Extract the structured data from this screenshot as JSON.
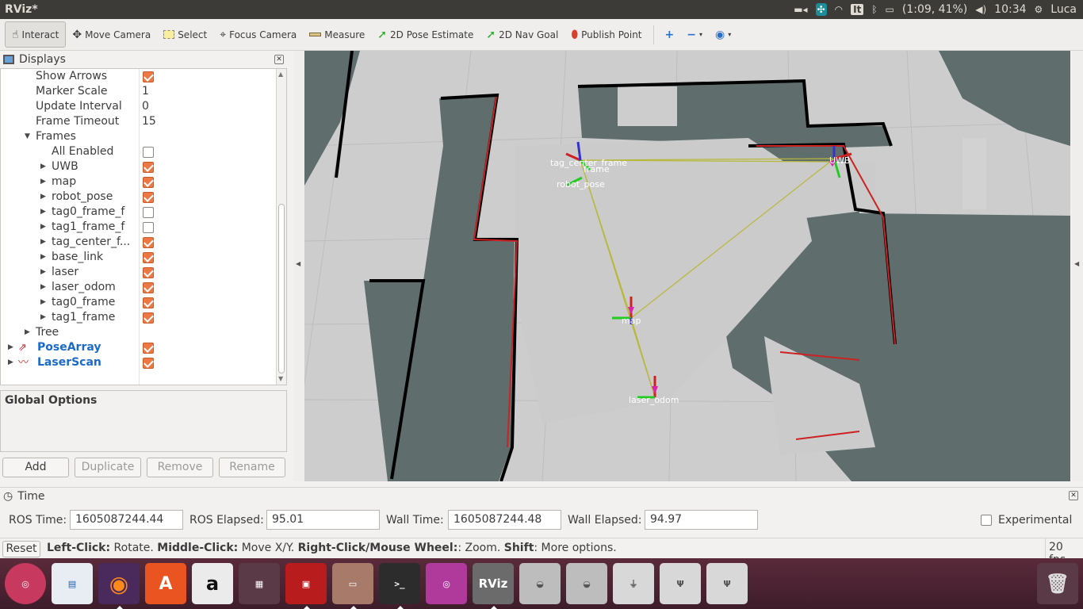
{
  "window": {
    "title": "RViz*"
  },
  "indicators": {
    "keyboard_layout": "It",
    "battery": "(1:09, 41%)",
    "clock": "10:34",
    "user": "Luca"
  },
  "toolbar": {
    "tools": [
      {
        "label": "Interact",
        "icon": "hand-icon"
      },
      {
        "label": "Move Camera",
        "icon": "camera-icon"
      },
      {
        "label": "Select",
        "icon": "select-box-icon"
      },
      {
        "label": "Focus Camera",
        "icon": "crosshair-icon"
      },
      {
        "label": "Measure",
        "icon": "ruler-icon"
      },
      {
        "label": "2D Pose Estimate",
        "icon": "green-arrow-icon"
      },
      {
        "label": "2D Nav Goal",
        "icon": "green-arrow-icon"
      },
      {
        "label": "Publish Point",
        "icon": "map-pin-icon"
      }
    ]
  },
  "displays": {
    "title": "Displays",
    "rows": [
      {
        "label": "Show Arrows",
        "indent": 44,
        "checkbox": true
      },
      {
        "label": "Marker Scale",
        "indent": 44,
        "value": "1"
      },
      {
        "label": "Update Interval",
        "indent": 44,
        "value": "0"
      },
      {
        "label": "Frame Timeout",
        "indent": 44,
        "value": "15"
      },
      {
        "label": "Frames",
        "indent": 44,
        "arrow": "down"
      },
      {
        "label": "All Enabled",
        "indent": 64,
        "checkbox": false
      },
      {
        "label": "UWB",
        "indent": 64,
        "arrow": "right",
        "checkbox": true
      },
      {
        "label": "map",
        "indent": 64,
        "arrow": "right",
        "checkbox": true
      },
      {
        "label": "robot_pose",
        "indent": 64,
        "arrow": "right",
        "checkbox": true
      },
      {
        "label": "tag0_frame_f",
        "indent": 64,
        "arrow": "right",
        "checkbox": false
      },
      {
        "label": "tag1_frame_f",
        "indent": 64,
        "arrow": "right",
        "checkbox": false
      },
      {
        "label": "tag_center_f...",
        "indent": 64,
        "arrow": "right",
        "checkbox": true
      },
      {
        "label": "base_link",
        "indent": 64,
        "arrow": "right",
        "checkbox": true
      },
      {
        "label": "laser",
        "indent": 64,
        "arrow": "right",
        "checkbox": true
      },
      {
        "label": "laser_odom",
        "indent": 64,
        "arrow": "right",
        "checkbox": true
      },
      {
        "label": "tag0_frame",
        "indent": 64,
        "arrow": "right",
        "checkbox": true
      },
      {
        "label": "tag1_frame",
        "indent": 64,
        "arrow": "right",
        "checkbox": true
      },
      {
        "label": "Tree",
        "indent": 44,
        "arrow": "right"
      },
      {
        "label": "PoseArray",
        "indent": 46,
        "arrow": "right",
        "checkbox": true,
        "top": true
      },
      {
        "label": "LaserScan",
        "indent": 46,
        "arrow": "right",
        "checkbox": true,
        "top": true
      }
    ],
    "global_options": "Global Options",
    "buttons": {
      "add": "Add",
      "duplicate": "Duplicate",
      "remove": "Remove",
      "rename": "Rename"
    }
  },
  "viewport": {
    "frame_labels": [
      {
        "text": "map"
      },
      {
        "text": "laser_odom"
      },
      {
        "text": "UWB"
      },
      {
        "text": "frame"
      },
      {
        "text": "tag_center_frame"
      },
      {
        "text": "robot_pose"
      }
    ]
  },
  "time": {
    "title": "Time",
    "ros_time_label": "ROS Time:",
    "ros_time": "1605087244.44",
    "ros_elapsed_label": "ROS Elapsed:",
    "ros_elapsed": "95.01",
    "wall_time_label": "Wall Time:",
    "wall_time": "1605087244.48",
    "wall_elapsed_label": "Wall Elapsed:",
    "wall_elapsed": "94.97",
    "experimental_label": "Experimental"
  },
  "status": {
    "reset": "Reset",
    "left_click": "Left-Click:",
    "left_click_desc": " Rotate. ",
    "middle_click": "Middle-Click:",
    "middle_click_desc": " Move X/Y. ",
    "right_click": "Right-Click/Mouse Wheel:",
    "right_click_desc": ": Zoom. ",
    "shift": "Shift",
    "shift_desc": ": More options.",
    "fps": "20 fps"
  },
  "launcher": {
    "rviz_icon_text": "RViz"
  },
  "colors": {
    "checkbox_on": "#ec7844",
    "map_occupied": "#5e6e6e",
    "map_free": "#c8c8c8",
    "launcher_bg": "#4a2232"
  }
}
